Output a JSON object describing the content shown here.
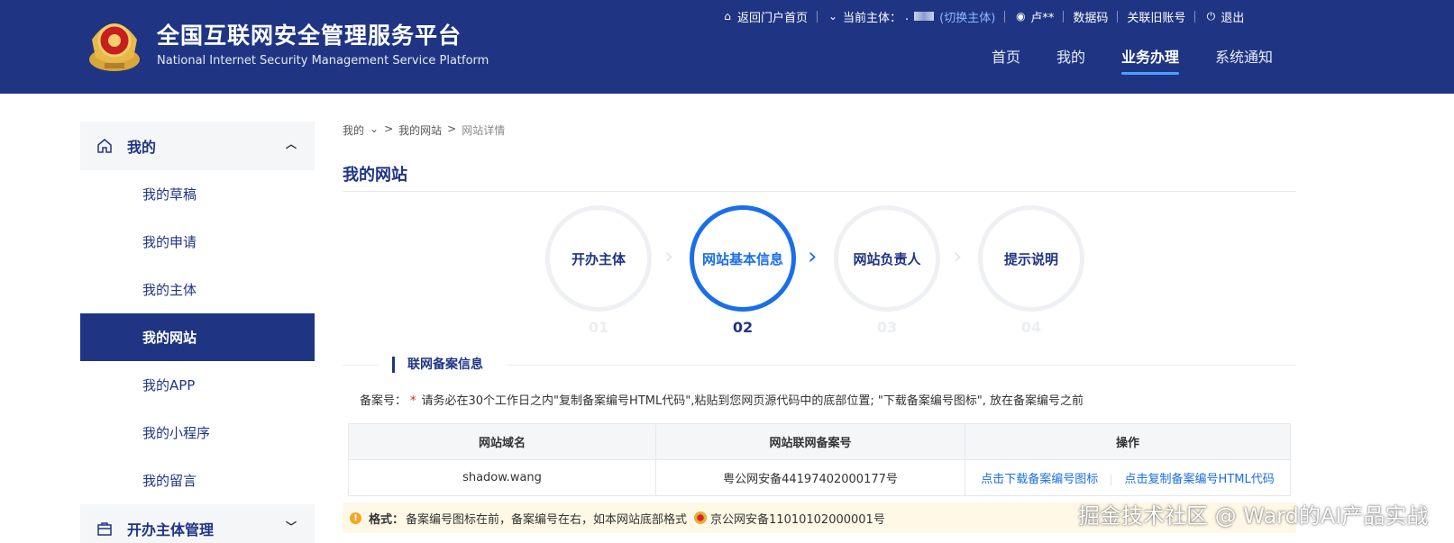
{
  "header": {
    "site_title": "全国互联网安全管理服务平台",
    "site_subtitle": "National Internet Security Management Service Platform",
    "colors": {
      "header_bg": "#1f3584",
      "accent": "#1a6fe8",
      "switch_link": "#8fb8ff"
    }
  },
  "topbar": {
    "portal_home": "返回门户首页",
    "current_subject_label": "当前主体：",
    "current_subject_value": ".",
    "switch_subject": "(切换主体)",
    "user_name": "卢**",
    "data_code": "数据码",
    "linked_old_account": "关联旧账号",
    "logout": "退出",
    "icons": [
      "home-icon",
      "chevron-down-icon",
      "user-icon",
      "power-icon"
    ]
  },
  "mainnav": {
    "items": [
      {
        "label": "首页",
        "active": false
      },
      {
        "label": "我的",
        "active": false
      },
      {
        "label": "业务办理",
        "active": true
      },
      {
        "label": "系统通知",
        "active": false
      }
    ]
  },
  "sidebar": {
    "group_mine": "我的",
    "items": [
      {
        "label": "我的草稿",
        "active": false
      },
      {
        "label": "我的申请",
        "active": false
      },
      {
        "label": "我的主体",
        "active": false
      },
      {
        "label": "我的网站",
        "active": true
      },
      {
        "label": "我的APP",
        "active": false
      },
      {
        "label": "我的小程序",
        "active": false
      },
      {
        "label": "我的留言",
        "active": false
      }
    ],
    "group_subject_mgmt": "开办主体管理"
  },
  "breadcrumb": {
    "level1": "我的",
    "sep": ">",
    "level2": "我的网站",
    "level3": "网站详情"
  },
  "page_title": "我的网站",
  "steps": [
    {
      "label": "开办主体",
      "num": "01",
      "active": false
    },
    {
      "label": "网站基本信息",
      "num": "02",
      "active": true
    },
    {
      "label": "网站负责人",
      "num": "03",
      "active": false
    },
    {
      "label": "提示说明",
      "num": "04",
      "active": false
    }
  ],
  "section": {
    "title": "联网备案信息",
    "record_label": "备案号：",
    "required_mark": "*",
    "record_hint": "请务必在30个工作日之内\"复制备案编号HTML代码\",粘贴到您网页源代码中的底部位置; \"下载备案编号图标\", 放在备案编号之前"
  },
  "table": {
    "headers": [
      "网站域名",
      "网站联网备案号",
      "操作"
    ],
    "rows": [
      {
        "domain": "shadow.wang",
        "record_no": "粤公网安备44197402000177号",
        "op_download": "点击下载备案编号图标",
        "op_copy": "点击复制备案编号HTML代码"
      }
    ]
  },
  "format_note": {
    "label": "格式：",
    "text": "备案编号图标在前，备案编号在右，如本网站底部格式",
    "example": "京公网安备11010102000001号"
  },
  "watermark": "掘金技术社区 @ Ward的AI产品实战"
}
